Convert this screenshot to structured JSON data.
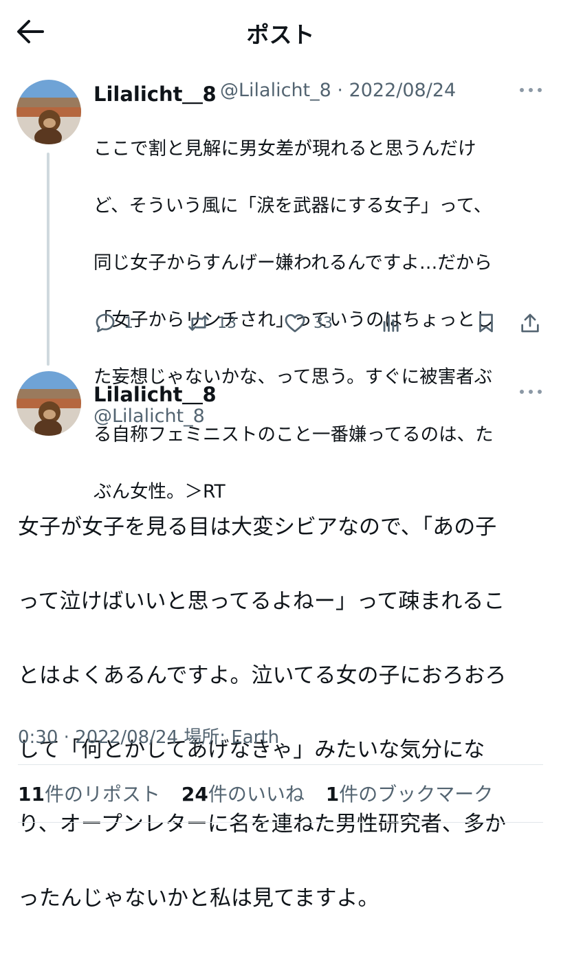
{
  "header": {
    "title": "ポスト"
  },
  "icons": {
    "back": "arrow-left-icon",
    "reply": "reply-icon",
    "repost": "repost-icon",
    "like": "heart-icon",
    "views": "bar-chart-icon",
    "bookmark": "bookmark-icon",
    "share": "share-icon",
    "more": "more-horizontal-icon"
  },
  "parent_post": {
    "display_name": "Lilalicht＿8",
    "handle_date": "@Lilalicht_8 · 2022/08/24",
    "lines": [
      "ここで割と見解に男女差が現れると思うんだけ",
      "ど、そういう風に「涙を武器にする女子」って、",
      "同じ女子からすんげー嫌われるんですよ…だから",
      "「女子からリンチされ」っていうのはちょっとし",
      "た妄想じゃないかな、って思う。すぐに被害者ぶ",
      "る自称フェミニストのこと一番嫌ってるのは、た",
      "ぶん女性。＞RT"
    ],
    "reply_count": "1",
    "repost_count": "13",
    "like_count": "33"
  },
  "main_post": {
    "display_name": "Lilalicht＿8",
    "handle": "@Lilalicht_8",
    "lines": [
      "女子が女子を見る目は大変シビアなので、「あの子",
      "って泣けばいいと思ってるよねー」って疎まれるこ",
      "とはよくあるんですよ。泣いてる女の子におろおろ",
      "して「何とかしてあげなきゃ」みたいな気分にな",
      "り、オープンレターに名を連ねた男性研究者、多か",
      "ったんじゃないかと私は見てますよ。"
    ],
    "timestamp": "0:30 · 2022/08/24 場所: Earth",
    "stats": {
      "reposts_count": "11",
      "reposts_label": "件のリポスト",
      "likes_count": "24",
      "likes_label": "件のいいね",
      "bookmarks_count": "1",
      "bookmarks_label": "件のブックマーク"
    }
  },
  "colors": {
    "text": "#0f1419",
    "secondary": "#536471",
    "thread_line": "#cfd9de",
    "divider": "#e1e6ea"
  }
}
